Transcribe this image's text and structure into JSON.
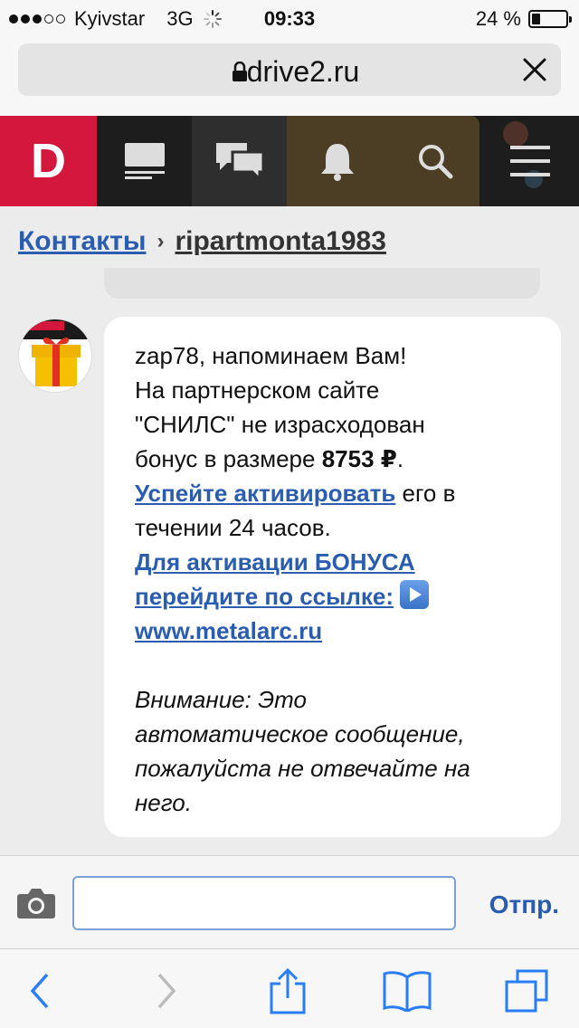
{
  "status": {
    "carrier": "Kyivstar",
    "network": "3G",
    "time": "09:33",
    "battery_text": "24 %",
    "battery_level": 0.24
  },
  "browser": {
    "host": "drive2.ru"
  },
  "site": {
    "logo_letter": "D",
    "nav_icons": [
      "feed-icon",
      "chat-icon",
      "bell-icon",
      "search-icon",
      "menu-icon"
    ],
    "accent_color": "#d4173c"
  },
  "breadcrumb": {
    "parent": "Контакты",
    "separator": "›",
    "current": "ripartmonta1983"
  },
  "message": {
    "line1": "zap78,  напоминаем Вам!",
    "line2": "На партнерском сайте",
    "line3": "\"СНИЛС\" не израсходован",
    "line4_prefix": "бонус в размере ",
    "amount": "8753 ₽",
    "line4_suffix": ".",
    "link1": "Успейте активировать",
    "line5_suffix": " его в",
    "line6": "течении 24 часов.",
    "link2_a": "Для активации БОНУСА",
    "link2_b": "перейдите по ссылке:",
    "link3": "www.metalarc.ru",
    "notice1": "Внимание: Это",
    "notice2": "автоматическое сообщение,",
    "notice3": "пожалуйста не отвечайте на",
    "notice4": "него."
  },
  "compose": {
    "value": "",
    "send_label": "Отпр."
  },
  "toolbar": {
    "icons": [
      "back-icon",
      "forward-icon",
      "share-icon",
      "bookmarks-icon",
      "tabs-icon"
    ]
  }
}
